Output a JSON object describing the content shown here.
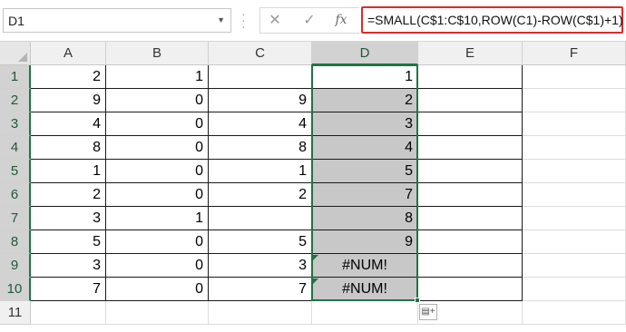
{
  "name_box": {
    "value": "D1",
    "dropdown_icon": "chevron-down-icon"
  },
  "formula_bar": {
    "cancel_icon": "✕",
    "enter_icon": "✓",
    "fx_label": "fx",
    "formula": "=SMALL(C$1:C$10,ROW(C1)-ROW(C$1)+1)",
    "highlight_color": "#e02a2a"
  },
  "columns": [
    "A",
    "B",
    "C",
    "D",
    "E",
    "F"
  ],
  "selected_column": "D",
  "rows": [
    "1",
    "2",
    "3",
    "4",
    "5",
    "6",
    "7",
    "8",
    "9",
    "10",
    "11"
  ],
  "selected_rows": [
    "1",
    "2",
    "3",
    "4",
    "5",
    "6",
    "7",
    "8",
    "9",
    "10"
  ],
  "cells": [
    {
      "A": "2",
      "B": "1",
      "C": "",
      "D": "1"
    },
    {
      "A": "9",
      "B": "0",
      "C": "9",
      "D": "2"
    },
    {
      "A": "4",
      "B": "0",
      "C": "4",
      "D": "3"
    },
    {
      "A": "8",
      "B": "0",
      "C": "8",
      "D": "4"
    },
    {
      "A": "1",
      "B": "0",
      "C": "1",
      "D": "5"
    },
    {
      "A": "2",
      "B": "0",
      "C": "2",
      "D": "7"
    },
    {
      "A": "3",
      "B": "1",
      "C": "",
      "D": "8"
    },
    {
      "A": "5",
      "B": "0",
      "C": "5",
      "D": "9"
    },
    {
      "A": "3",
      "B": "0",
      "C": "3",
      "D": "#NUM!"
    },
    {
      "A": "7",
      "B": "0",
      "C": "7",
      "D": "#NUM!"
    }
  ],
  "colors": {
    "selection": "#217346",
    "shade": "#c8c8c8",
    "header_bg": "#f0f0f0",
    "header_selected": "#d2d2d2"
  },
  "quick_analysis_icon": "quick-analysis-icon"
}
